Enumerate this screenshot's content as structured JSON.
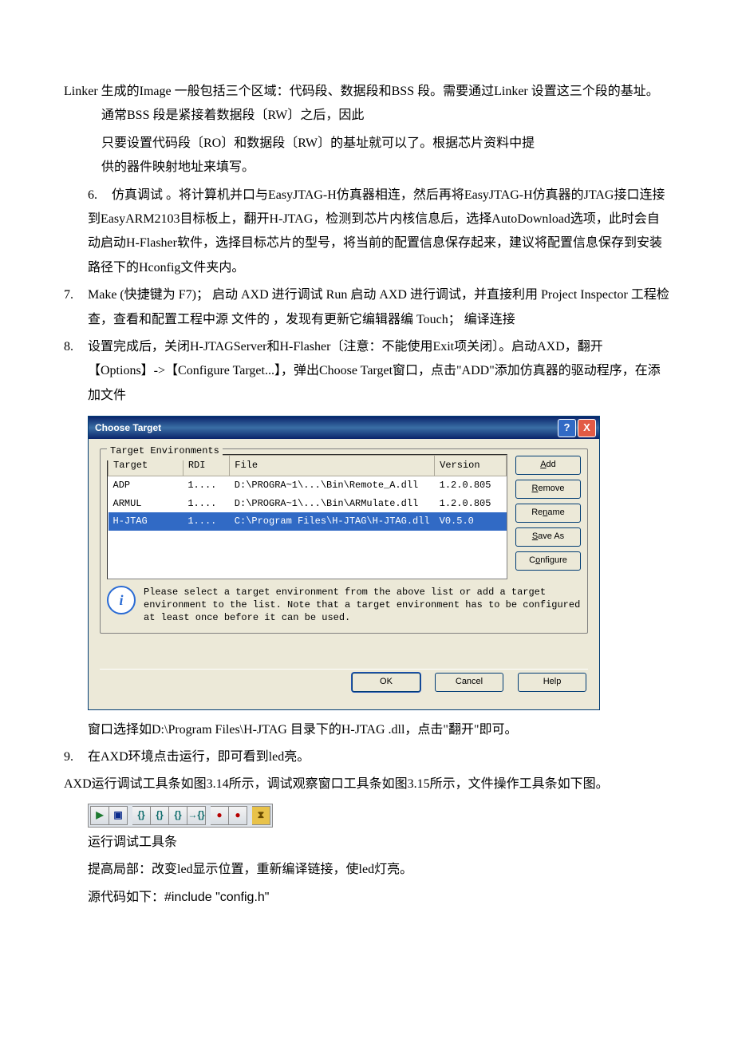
{
  "paragraphs": {
    "p1": "Linker 生成的Image 一般包括三个区域：代码段、数据段和BSS 段。需要通过Linker 设置这三个段的基址。通常BSS 段是紧接着数据段〔RW〕之后，因此",
    "p2": "只要设置代码段〔RO〕和数据段〔RW〕的基址就可以了。根据芯片资料中提　　　　　　　　　　供的器件映射地址来填写。",
    "p6": "仿真调试 。将计算机并口与EasyJTAG-H仿真器相连，然后再将EasyJTAG-H仿真器的JTAG接口连接到EasyARM2103目标板上，翻开H-JTAG，检测到芯片内核信息后，选择AutoDownload选项，此时会自动启动H-Flasher软件，选择目标芯片的型号，将当前的配置信息保存起来，建议将配置信息保存到安装路径下的Hconfig文件夹内。",
    "p7": " Make (快捷键为 F7)； 启动 AXD 进行调试 Run 启动 AXD 进行调试，并直接利用 Project Inspector 工程检查，查看和配置工程中源  文件的 ，发现有更新它编辑器编 Touch；  编译连接",
    "p8": "设置完成后，关闭H-JTAGServer和H-Flasher〔注意：不能使用Exit项关闭〕。启动AXD，翻开【Options】->【Configure Target...】，弹出Choose Target窗口，点击\"ADD\"添加仿真器的驱动程序，在添加文件",
    "p8b": "窗口选择如D:\\Program Files\\H-JTAG 目录下的H-JTAG .dll，点击\"翻开\"即可。",
    "p9": "在AXD环境点击运行，即可看到led亮。",
    "p10": "AXD运行调试工具条如图3.14所示，调试观察窗口工具条如图3.15所示，文件操作工具条如下图。",
    "caption": "运行调试工具条",
    "p11": "提高局部：改变led显示位置，重新编译链接，使led灯亮。",
    "p12a": "源代码如下：",
    "p12b": "#include \"config.h\""
  },
  "list_numbers": {
    "n6": "6.",
    "n7": "7.",
    "n8": "8.",
    "n9": "9."
  },
  "dialog": {
    "title": "Choose Target",
    "group_label": "Target Environments",
    "headers": {
      "target": "Target",
      "rdi": "RDI",
      "file": "File",
      "version": "Version"
    },
    "rows": [
      {
        "target": "ADP",
        "rdi": "1....",
        "file": "D:\\PROGRA~1\\...\\Bin\\Remote_A.dll",
        "version": "1.2.0.805"
      },
      {
        "target": "ARMUL",
        "rdi": "1....",
        "file": "D:\\PROGRA~1\\...\\Bin\\ARMulate.dll",
        "version": "1.2.0.805"
      },
      {
        "target": "H-JTAG",
        "rdi": "1....",
        "file": "C:\\Program Files\\H-JTAG\\H-JTAG.dll",
        "version": "V0.5.0"
      }
    ],
    "buttons": {
      "add": {
        "pre": "",
        "u": "A",
        "post": "dd"
      },
      "remove": {
        "pre": "",
        "u": "R",
        "post": "emove"
      },
      "rename": {
        "pre": "Re",
        "u": "n",
        "post": "ame"
      },
      "saveas": {
        "pre": "",
        "u": "S",
        "post": "ave As"
      },
      "configure": {
        "pre": "C",
        "u": "o",
        "post": "nfigure"
      }
    },
    "info": "Please select a target environment from the above list or add a target environment to the list. Note that a target environment has to be configured at least once before it can be used.",
    "ok": "OK",
    "cancel": "Cancel",
    "help": "Help",
    "help_icon": "?",
    "close_icon": "X",
    "info_icon": "i"
  },
  "toolbar": {
    "go": "▶",
    "stop": "▣",
    "step_into": "{}",
    "step_over": "{}",
    "step_out": "{}",
    "run_to": "→{}",
    "bp_set": "●",
    "bp_toggle": "●",
    "hourglass": "⧗"
  }
}
